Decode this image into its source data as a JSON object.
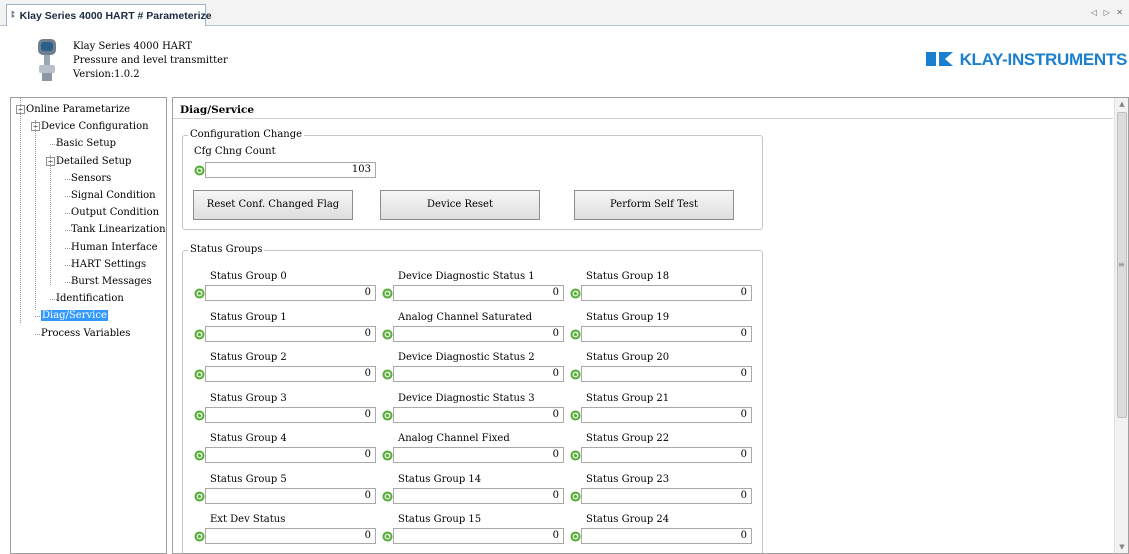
{
  "tab": {
    "title": "Klay Series 4000 HART # Parameterize",
    "icon": "device-icon",
    "nav_arrows": "◁ ▷ ✕"
  },
  "header": {
    "device_name": "Klay Series 4000 HART",
    "description": "Pressure and level transmitter",
    "version": "Version:1.0.2",
    "logo_text": "KLAY-INSTRUMENTS",
    "logo_color": "#1b7fd0"
  },
  "tree": {
    "items": [
      {
        "label": "Online Parametarize"
      },
      {
        "label": "Device Configuration"
      },
      {
        "label": "Basic Setup"
      },
      {
        "label": "Detailed Setup"
      },
      {
        "label": "Sensors"
      },
      {
        "label": "Signal Condition"
      },
      {
        "label": "Output Condition"
      },
      {
        "label": "Tank Linearization"
      },
      {
        "label": "Human Interface"
      },
      {
        "label": "HART Settings"
      },
      {
        "label": "Burst Messages"
      },
      {
        "label": "Identification"
      },
      {
        "label": "Diag/Service",
        "selected": true
      },
      {
        "label": "Process Variables"
      }
    ]
  },
  "main": {
    "title": "Diag/Service",
    "config_change": {
      "legend": "Configuration Change",
      "count_label": "Cfg Chng Count",
      "count_value": "103",
      "buttons": [
        "Reset Conf. Changed Flag",
        "Device Reset",
        "Perform Self Test"
      ]
    },
    "status_groups": {
      "legend": "Status Groups",
      "columns": [
        [
          {
            "label": "Status Group 0",
            "value": "0"
          },
          {
            "label": "Status Group 1",
            "value": "0"
          },
          {
            "label": "Status Group 2",
            "value": "0"
          },
          {
            "label": "Status Group 3",
            "value": "0"
          },
          {
            "label": "Status Group 4",
            "value": "0"
          },
          {
            "label": "Status Group 5",
            "value": "0"
          },
          {
            "label": "Ext Dev Status",
            "value": "0"
          }
        ],
        [
          {
            "label": "Device Diagnostic Status 1",
            "value": "0"
          },
          {
            "label": "Analog Channel Saturated",
            "value": "0"
          },
          {
            "label": "Device Diagnostic Status 2",
            "value": "0"
          },
          {
            "label": "Device Diagnostic Status 3",
            "value": "0"
          },
          {
            "label": "Analog Channel Fixed",
            "value": "0"
          },
          {
            "label": "Status Group 14",
            "value": "0"
          },
          {
            "label": "Status Group 15",
            "value": "0"
          }
        ],
        [
          {
            "label": "Status Group 18",
            "value": "0"
          },
          {
            "label": "Status Group 19",
            "value": "0"
          },
          {
            "label": "Status Group 20",
            "value": "0"
          },
          {
            "label": "Status Group 21",
            "value": "0"
          },
          {
            "label": "Status Group 22",
            "value": "0"
          },
          {
            "label": "Status Group 23",
            "value": "0"
          },
          {
            "label": "Status Group 24",
            "value": "0"
          }
        ]
      ]
    }
  },
  "colors": {
    "selection": "#3399ff",
    "refresh_icon": "#5aae3c"
  }
}
